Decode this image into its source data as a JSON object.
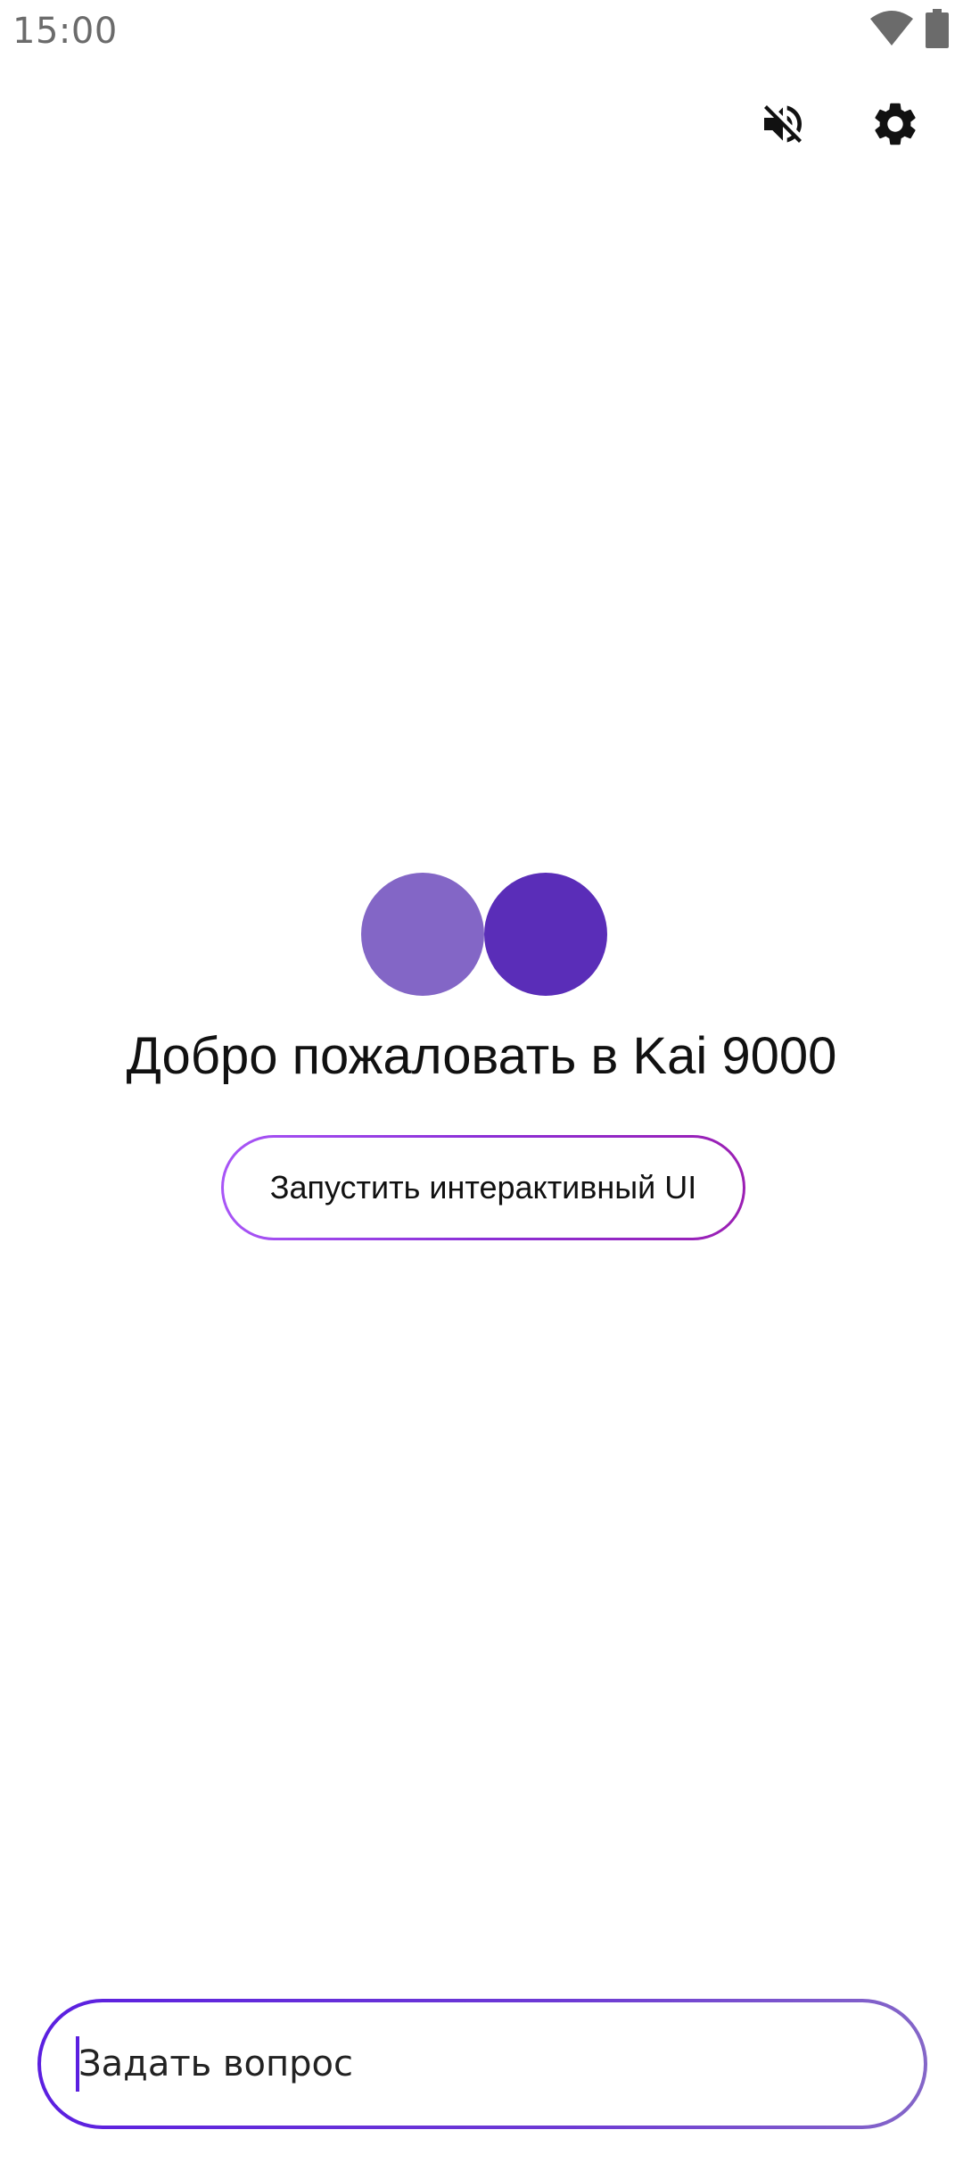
{
  "status_bar": {
    "time": "15:00",
    "icons": [
      "wifi-icon",
      "battery-icon"
    ]
  },
  "toolbar": {
    "mute_icon": "volume-off-icon",
    "settings_icon": "gear-icon"
  },
  "logo": {
    "left_color": "#8366c6",
    "right_color": "#5a2db8"
  },
  "welcome": {
    "title": "Добро пожаловать в Kai 9000"
  },
  "launch_button": {
    "label": "Запустить интерактивный UI"
  },
  "ask": {
    "placeholder": "Задать вопрос"
  },
  "colors": {
    "accent": "#5b1fe0",
    "button_border": "#a855f7"
  }
}
